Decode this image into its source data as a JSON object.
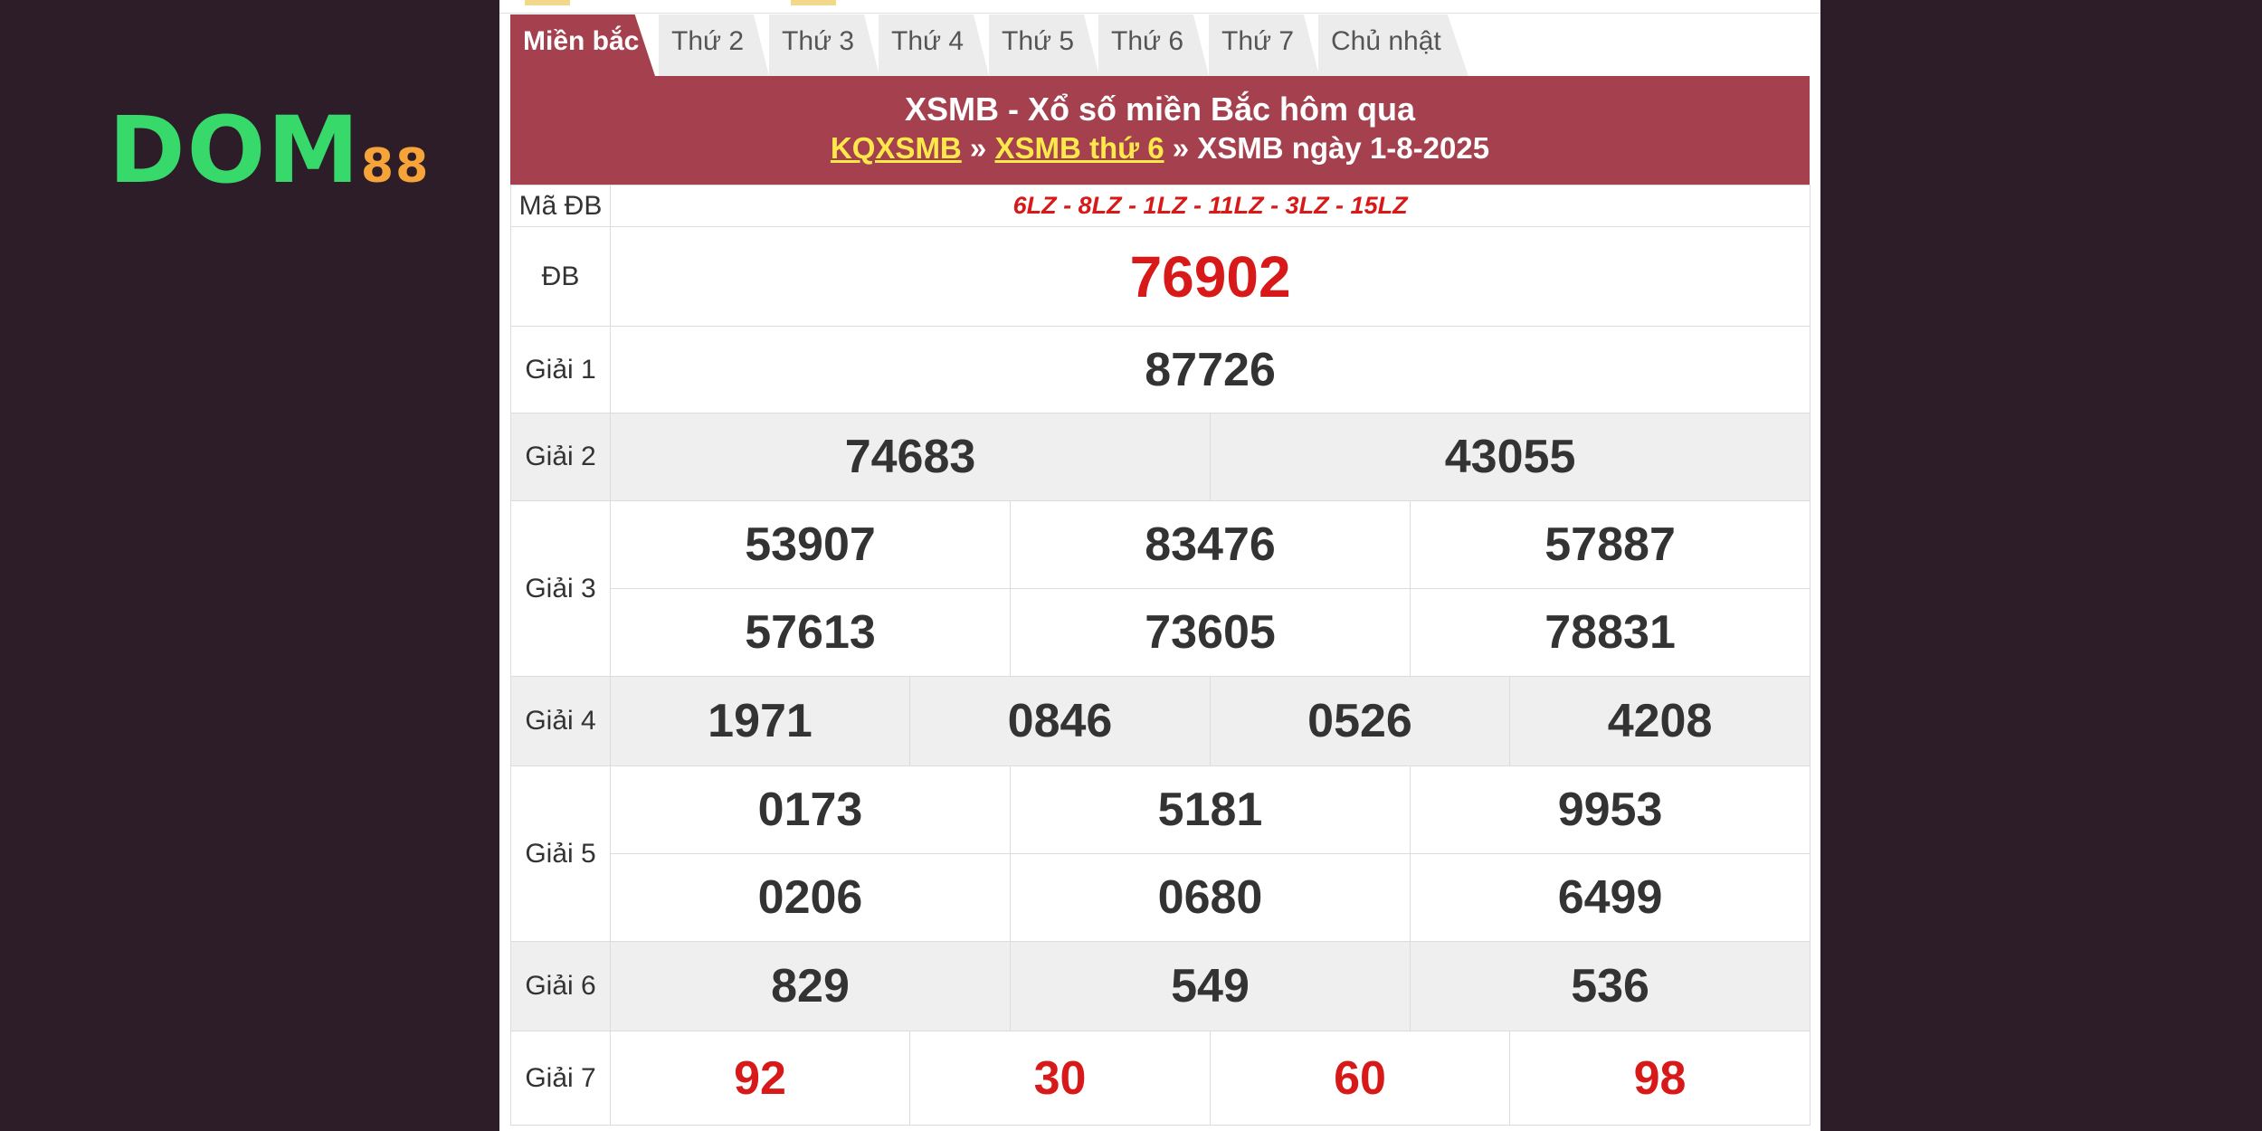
{
  "logo": {
    "part1": "DOM",
    "part2": "88"
  },
  "tabs": [
    "Miền bắc",
    "Thứ 2",
    "Thứ 3",
    "Thứ 4",
    "Thứ 5",
    "Thứ 6",
    "Thứ 7",
    "Chủ nhật"
  ],
  "header": {
    "title": "XSMB - Xổ số miền Bắc hôm qua",
    "crumb1": "KQXSMB",
    "sep1": " » ",
    "crumb2": "XSMB thứ 6",
    "sep2": " » ",
    "crumb3": "XSMB ngày 1-8-2025"
  },
  "results": {
    "ma_db_label": "Mã ĐB",
    "ma_db": "6LZ - 8LZ - 1LZ - 11LZ - 3LZ - 15LZ",
    "db_label": "ĐB",
    "db": "76902",
    "g1_label": "Giải 1",
    "g1": "87726",
    "g2_label": "Giải 2",
    "g2": [
      "74683",
      "43055"
    ],
    "g3_label": "Giải 3",
    "g3": [
      "53907",
      "83476",
      "57887",
      "57613",
      "73605",
      "78831"
    ],
    "g4_label": "Giải 4",
    "g4": [
      "1971",
      "0846",
      "0526",
      "4208"
    ],
    "g5_label": "Giải 5",
    "g5": [
      "0173",
      "5181",
      "9953",
      "0206",
      "0680",
      "6499"
    ],
    "g6_label": "Giải 6",
    "g6": [
      "829",
      "549",
      "536"
    ],
    "g7_label": "Giải 7",
    "g7": [
      "92",
      "30",
      "60",
      "98"
    ]
  },
  "colors": {
    "accent": "#a5414e",
    "prize_red": "#d71919",
    "link_yellow": "#ffe94a",
    "bg": "#2c1d28"
  }
}
